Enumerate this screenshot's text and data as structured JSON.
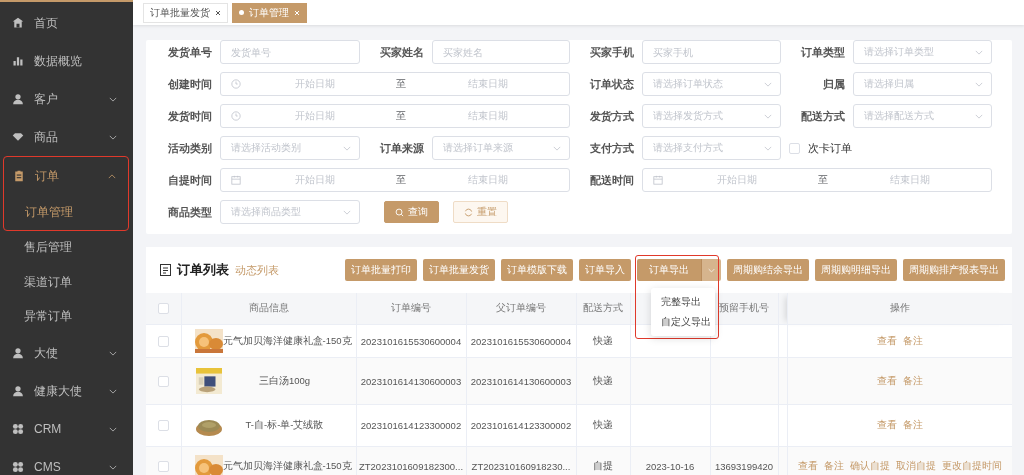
{
  "sidebar": {
    "items": [
      {
        "label": "首页",
        "selected": false
      },
      {
        "label": "数据概览",
        "selected": false
      },
      {
        "label": "客户",
        "selected": false,
        "expanded": false
      },
      {
        "label": "商品",
        "selected": false,
        "expanded": false
      },
      {
        "label": "订单",
        "selected": true,
        "expanded": true,
        "highlighted": true,
        "children": [
          {
            "label": "订单管理",
            "selected": true,
            "highlighted": true
          },
          {
            "label": "售后管理",
            "selected": false
          },
          {
            "label": "渠道订单",
            "selected": false
          },
          {
            "label": "异常订单",
            "selected": false
          }
        ]
      },
      {
        "label": "大使",
        "selected": false,
        "expanded": false
      },
      {
        "label": "健康大使",
        "selected": false,
        "expanded": false
      },
      {
        "label": "CRM",
        "selected": false,
        "expanded": false
      },
      {
        "label": "CMS",
        "selected": false,
        "expanded": false
      }
    ]
  },
  "tabs": [
    {
      "label": "订单批量发货",
      "selected": false
    },
    {
      "label": "订单管理",
      "selected": true
    }
  ],
  "filter_form": {
    "rows": [
      [
        {
          "kind": "input",
          "label": "发货单号",
          "placeholder": "发货单号"
        },
        {
          "kind": "input",
          "label": "买家姓名",
          "placeholder": "买家姓名"
        },
        {
          "kind": "input",
          "label": "买家手机",
          "placeholder": "买家手机"
        },
        {
          "kind": "select",
          "label": "订单类型",
          "placeholder": "请选择订单类型"
        }
      ],
      [
        {
          "kind": "datetimerange",
          "label": "创建时间",
          "start_placeholder": "开始日期",
          "separator": "至",
          "end_placeholder": "结束日期"
        },
        {
          "kind": "select",
          "label": "订单状态",
          "placeholder": "请选择订单状态"
        },
        {
          "kind": "select",
          "label": "归属",
          "placeholder": "请选择归属"
        }
      ],
      [
        {
          "kind": "datetimerange",
          "label": "发货时间",
          "start_placeholder": "开始日期",
          "separator": "至",
          "end_placeholder": "结束日期"
        },
        {
          "kind": "select",
          "label": "发货方式",
          "placeholder": "请选择发货方式"
        },
        {
          "kind": "select",
          "label": "配送方式",
          "placeholder": "请选择配送方式"
        }
      ],
      [
        {
          "kind": "select",
          "label": "活动类别",
          "placeholder": "请选择活动类别"
        },
        {
          "kind": "select",
          "label": "订单来源",
          "placeholder": "请选择订单来源"
        },
        {
          "kind": "select",
          "label": "支付方式",
          "placeholder": "请选择支付方式"
        },
        {
          "kind": "checkbox",
          "label": "次卡订单",
          "checked": false
        }
      ],
      [
        {
          "kind": "daterange",
          "label": "自提时间",
          "start_placeholder": "开始日期",
          "separator": "至",
          "end_placeholder": "结束日期"
        },
        {
          "kind": "daterange",
          "label": "配送时间",
          "start_placeholder": "开始日期",
          "separator": "至",
          "end_placeholder": "结束日期"
        }
      ],
      [
        {
          "kind": "select",
          "label": "商品类型",
          "placeholder": "请选择商品类型"
        },
        {
          "kind": "buttons",
          "buttons": [
            {
              "label": "查询",
              "kind": "primary"
            },
            {
              "label": "重置",
              "kind": "plain"
            }
          ]
        }
      ]
    ]
  },
  "order_list": {
    "title": "订单列表",
    "subtitle": "动态列表",
    "toolbar": [
      {
        "label": "订单批量打印",
        "kind": "plain"
      },
      {
        "label": "订单批量发货",
        "kind": "plain"
      },
      {
        "label": "订单模版下载",
        "kind": "plain"
      },
      {
        "label": "订单导入",
        "kind": "plain"
      },
      {
        "label": "订单导出",
        "kind": "split",
        "highlighted": true,
        "menu": {
          "expanded": true,
          "items": [
            "完整导出",
            "自定义导出"
          ]
        }
      },
      {
        "label": "周期购结余导出",
        "kind": "plain"
      },
      {
        "label": "周期购明细导出",
        "kind": "plain"
      },
      {
        "label": "周期购排产报表导出",
        "kind": "plain"
      }
    ],
    "table": {
      "all_selected": false,
      "columns": {
        "product": "商品信息",
        "order_no": "订单编号",
        "parent_order_no": "父订单编号",
        "delivery": "配送方式",
        "phone": "预留手机号",
        "actions": "操作"
      },
      "rows": [
        {
          "selected": false,
          "thumbnail": {
            "kind": "picture"
          },
          "product": "元气加贝海洋健康礼盒-150克",
          "order_no": "2023101615530600004",
          "parent_order_no": "2023101615530600004",
          "delivery": "快递",
          "actions": [
            "查看",
            "备注"
          ]
        },
        {
          "selected": false,
          "thumbnail": {
            "kind": "picture"
          },
          "product": "三白汤100g",
          "order_no": "2023101614130600003",
          "parent_order_no": "2023101614130600003",
          "delivery": "快递",
          "actions": [
            "查看",
            "备注"
          ]
        },
        {
          "selected": false,
          "thumbnail": {
            "kind": "picture"
          },
          "product": "T-自-标-单-艾绒散",
          "order_no": "2023101614123300002",
          "parent_order_no": "2023101614123300002",
          "delivery": "快递",
          "actions": [
            "查看",
            "备注"
          ]
        },
        {
          "selected": false,
          "thumbnail": {
            "kind": "picture"
          },
          "product": "元气加贝海洋健康礼盒-150克",
          "order_no": "ZT2023101609182300...",
          "parent_order_no": "ZT202310160918230...",
          "delivery": "自提",
          "column_5": "2023-10-16",
          "phone": "13693199420",
          "actions": [
            "查看",
            "备注",
            "确认自提",
            "取消自提",
            "更改自提时间"
          ]
        }
      ]
    }
  }
}
